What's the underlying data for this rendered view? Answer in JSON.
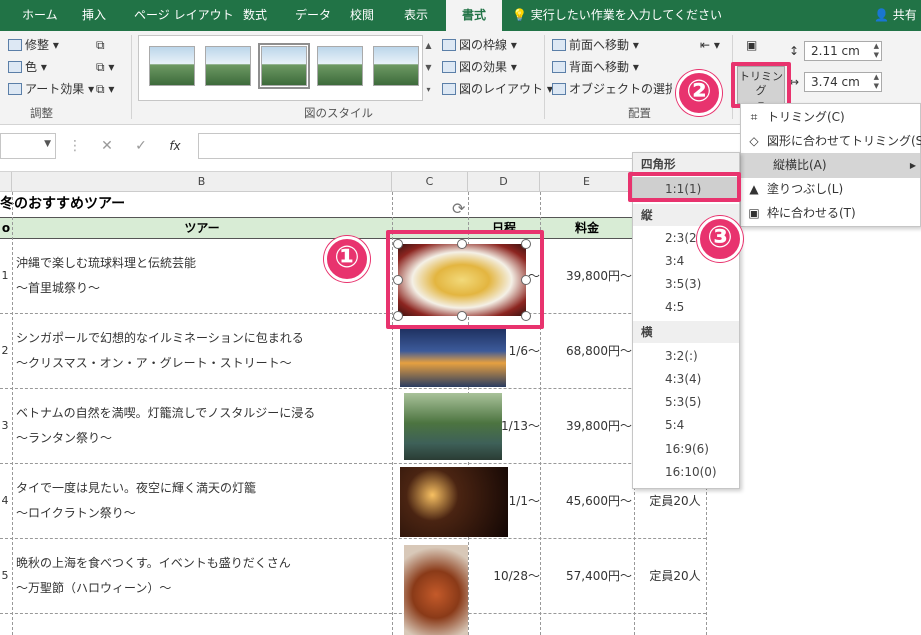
{
  "tabs": [
    "ホーム",
    "挿入",
    "ページ レイアウト",
    "数式",
    "データ",
    "校閲",
    "表示",
    "書式"
  ],
  "tell_me": "実行したい作業を入力してください",
  "share": "共有",
  "ribbon": {
    "adjust": {
      "corrections": "修整",
      "color": "色",
      "artistic": "アート効果",
      "label": "調整"
    },
    "styles": {
      "border": "図の枠線",
      "effects": "図の効果",
      "layout": "図のレイアウト",
      "label": "図のスタイル"
    },
    "arrange": {
      "bring_forward": "前面へ移動",
      "send_backward": "背面へ移動",
      "selection_pane": "オブジェクトの選択と",
      "label": "配置"
    },
    "size": {
      "height": "2.11 cm",
      "width": "3.74 cm",
      "crop": "トリミング"
    }
  },
  "formula_bar": {
    "fx": "fx"
  },
  "columns": [
    "B",
    "C",
    "D",
    "E"
  ],
  "sheet": {
    "title": "冬のおすすめツアー",
    "headers": {
      "no": "o",
      "tour": "ツアー",
      "schedule": "日程",
      "price": "料金"
    },
    "rows": [
      {
        "no": "1",
        "line1": "沖縄で楽しむ琉球料理と伝統芸能",
        "line2": "～首里城祭り～",
        "date": "～",
        "price": "39,800円～",
        "cap": ""
      },
      {
        "no": "2",
        "line1": "シンガポールで幻想的なイルミネーションに包まれる",
        "line2": "～クリスマス・オン・ア・グレート・ストリート～",
        "date": "1/6～",
        "price": "68,800円～",
        "cap": ""
      },
      {
        "no": "3",
        "line1": "ベトナムの自然を満喫。灯籠流しでノスタルジーに浸る",
        "line2": "～ランタン祭り～",
        "date": "1/13～",
        "price": "39,800円～",
        "cap": ""
      },
      {
        "no": "4",
        "line1": "タイで一度は見たい。夜空に輝く満天の灯籠",
        "line2": "～ロイクラトン祭り～",
        "date": "1/1～",
        "price": "45,600円～",
        "cap": "定員20人"
      },
      {
        "no": "5",
        "line1": "晩秋の上海を食べつくす。イベントも盛りだくさん",
        "line2": "～万聖節（ハロウィーン）～",
        "date": "10/28～",
        "price": "57,400円～",
        "cap": "定員20人"
      }
    ]
  },
  "crop_menu": {
    "items": [
      "トリミング(C)",
      "図形に合わせてトリミング(S)",
      "縦横比(A)",
      "塗りつぶし(L)",
      "枠に合わせる(T)"
    ],
    "arrow": "▶"
  },
  "aspect_menu": {
    "square_header": "四角形",
    "square": [
      "1:1(1)"
    ],
    "portrait_header": "縦",
    "portrait": [
      "2:3(2)",
      "3:4",
      "3:5(3)",
      "4:5"
    ],
    "landscape_header": "横",
    "landscape": [
      "3:2(:)",
      "4:3(4)",
      "5:3(5)",
      "5:4",
      "16:9(6)",
      "16:10(0)"
    ]
  },
  "callouts": [
    "①",
    "②",
    "③"
  ]
}
